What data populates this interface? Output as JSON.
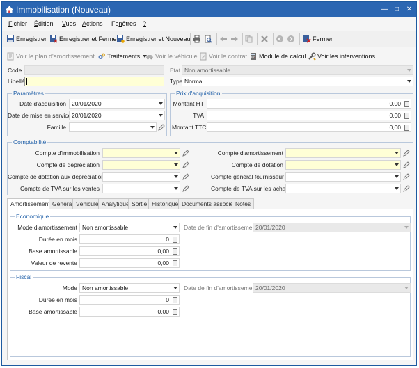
{
  "window": {
    "title": "Immobilisation (Nouveau)"
  },
  "menu": [
    {
      "u": "F",
      "rest": "ichier"
    },
    {
      "u": "É",
      "rest": "dition"
    },
    {
      "u": "V",
      "rest": "ues"
    },
    {
      "u": "A",
      "rest": "ctions"
    },
    {
      "pre": "Fe",
      "u": "n",
      "rest": "êtres"
    },
    {
      "u": "?",
      "rest": ""
    }
  ],
  "toolbar": {
    "save": "Enregistrer",
    "save_close": "Enregistrer et Fermer",
    "save_new": "Enregistrer et Nouveau",
    "close": "Fermer"
  },
  "toolbar2": {
    "plan": "Voir le plan d'amortissement",
    "traitements": "Traitements",
    "vehicule": "Voir le véhicule",
    "contrat": "Voir le contrat",
    "module": "Module de calcul",
    "interventions": "Voir les interventions"
  },
  "header": {
    "code_label": "Code",
    "code_value": "",
    "libelle_label": "Libellé",
    "libelle_value": "",
    "etat_label": "Etat",
    "etat_value": "Non amortissable",
    "type_label": "Type",
    "type_value": "Normal"
  },
  "parametres": {
    "title": "Paramètres",
    "date_acq_label": "Date d'acquisition",
    "date_acq_value": "20/01/2020",
    "date_mes_label": "Date de mise en service",
    "date_mes_value": "20/01/2020",
    "famille_label": "Famille",
    "famille_value": ""
  },
  "prix": {
    "title": "Prix d'acquisition",
    "ht_label": "Montant HT",
    "ht_value": "0,00",
    "tva_label": "TVA",
    "tva_value": "0,00",
    "ttc_label": "Montant TTC",
    "ttc_value": "0,00"
  },
  "comptabilite": {
    "title": "Comptabilité",
    "left": [
      "Compte d'immobilisation",
      "Compte de dépréciation",
      "Compte de dotation aux dépréciations",
      "Compte de TVA sur les ventes"
    ],
    "right": [
      "Compte d'amortissement",
      "Compte de dotation",
      "Compte général fournisseur",
      "Compte de TVA sur les achats"
    ]
  },
  "tabs": [
    "Amortissement",
    "Général",
    "Véhicule",
    "Analytique",
    "Sortie",
    "Historique",
    "Documents associés",
    "Notes"
  ],
  "economique": {
    "title": "Economique",
    "mode_label": "Mode d'amortissement",
    "mode_value": "Non amortissable",
    "fin_label": "Date de fin d'amortissement",
    "fin_value": "20/01/2020",
    "duree_label": "Durée en mois",
    "duree_value": "0",
    "base_label": "Base amortissable",
    "base_value": "0,00",
    "revente_label": "Valeur de revente",
    "revente_value": "0,00"
  },
  "fiscal": {
    "title": "Fiscal",
    "mode_label": "Mode",
    "mode_value": "Non amortissable",
    "fin_label": "Date de fin d'amortissement",
    "fin_value": "20/01/2020",
    "duree_label": "Durée en mois",
    "duree_value": "0",
    "base_label": "Base amortissable",
    "base_value": "0,00"
  },
  "colors": {
    "titlebar": "#2b66b2",
    "group_title": "#1f5fa8",
    "required": "#ffffd6"
  }
}
